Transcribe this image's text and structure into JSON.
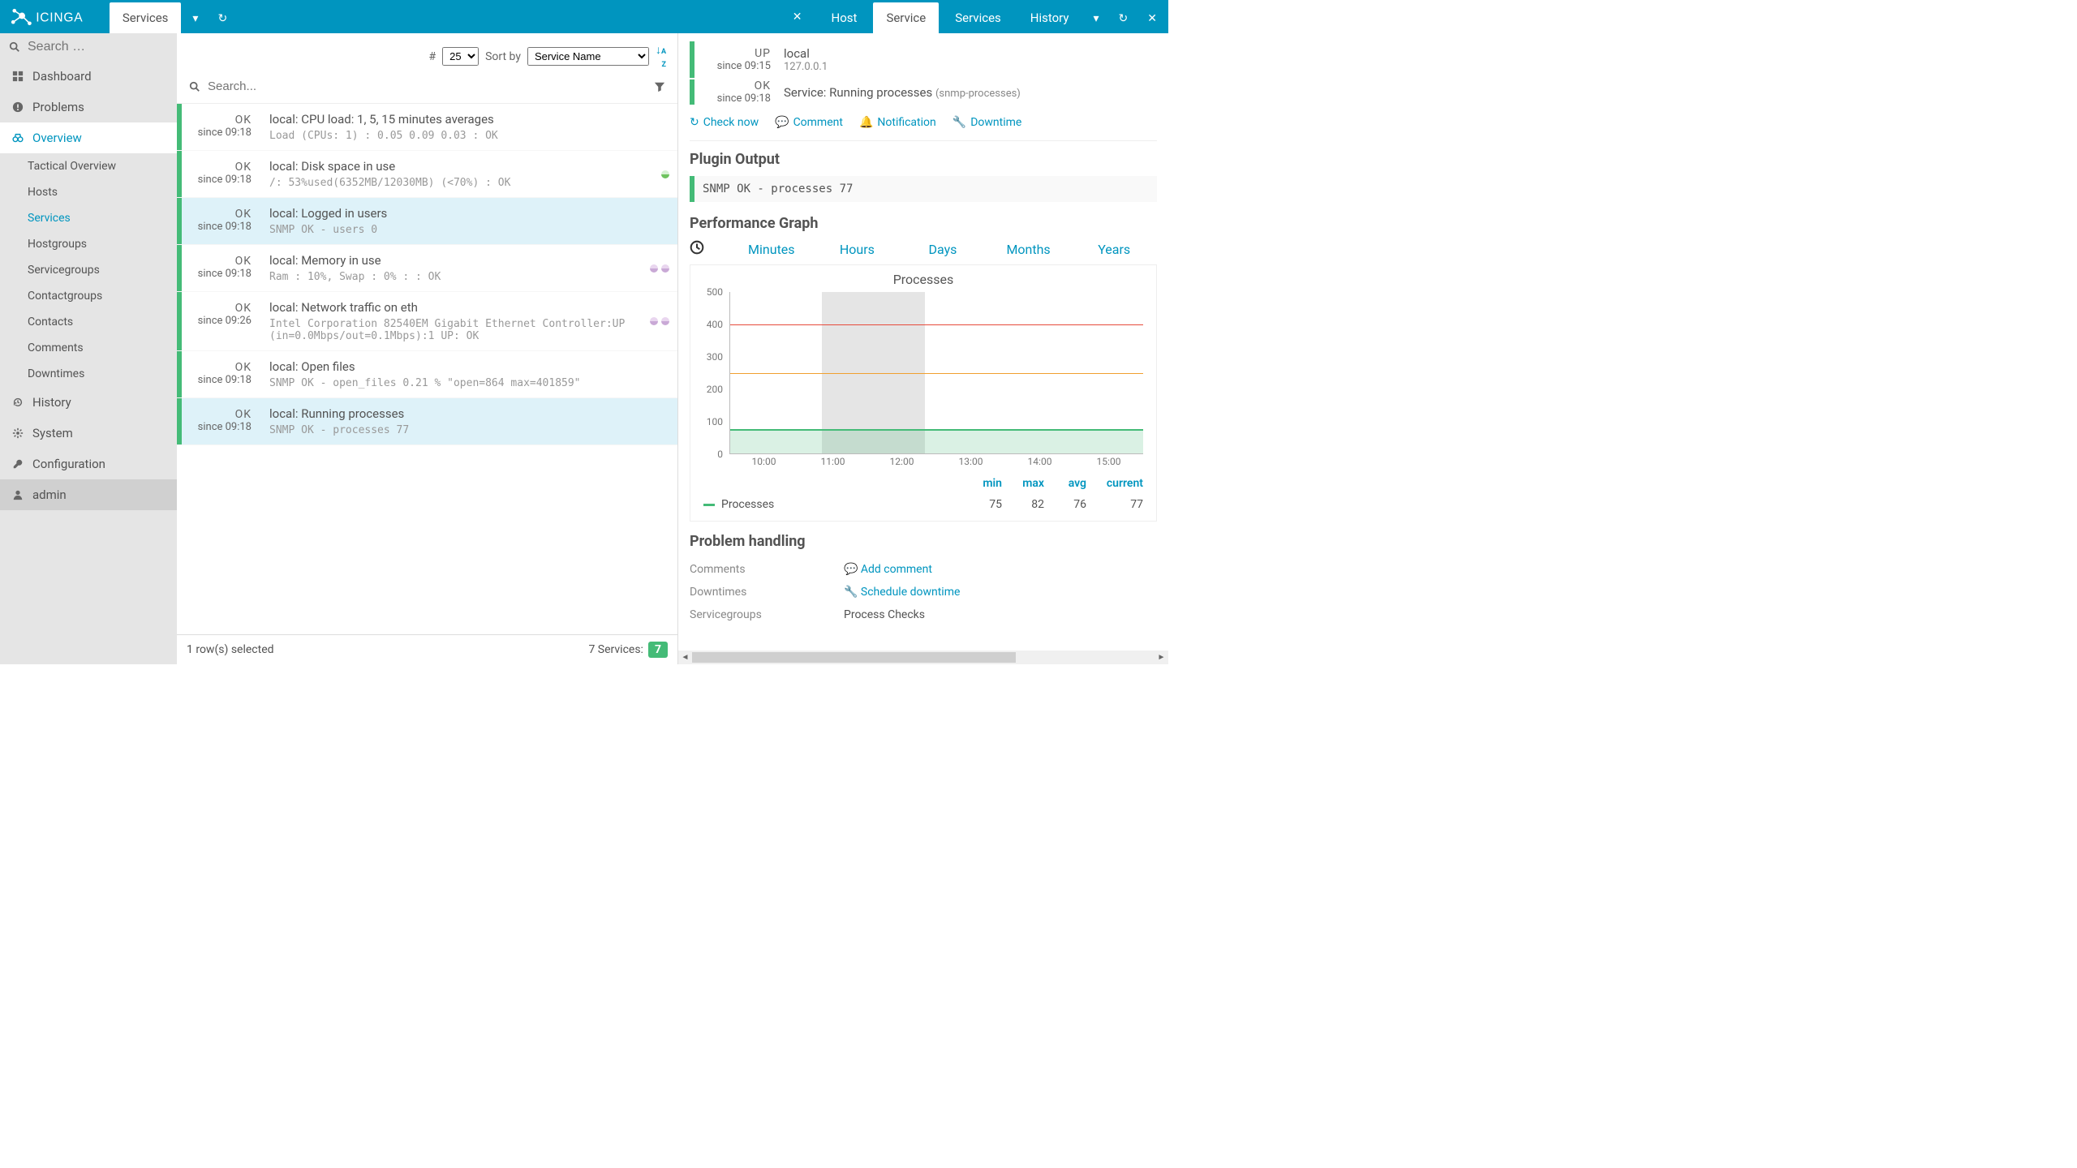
{
  "brand": "ICINGA",
  "topbar": {
    "left_tabs": [
      {
        "label": "Services",
        "active": true
      }
    ],
    "right_tabs": [
      {
        "label": "Host",
        "active": false
      },
      {
        "label": "Service",
        "active": true
      },
      {
        "label": "Services",
        "active": false
      },
      {
        "label": "History",
        "active": false
      }
    ]
  },
  "sidebar": {
    "search_placeholder": "Search …",
    "items": [
      {
        "icon": "dashboard",
        "label": "Dashboard"
      },
      {
        "icon": "alert",
        "label": "Problems"
      },
      {
        "icon": "binoc",
        "label": "Overview",
        "active": true,
        "children": [
          {
            "label": "Tactical Overview"
          },
          {
            "label": "Hosts"
          },
          {
            "label": "Services",
            "active": true
          },
          {
            "label": "Hostgroups"
          },
          {
            "label": "Servicegroups"
          },
          {
            "label": "Contactgroups"
          },
          {
            "label": "Contacts"
          },
          {
            "label": "Comments"
          },
          {
            "label": "Downtimes"
          }
        ]
      },
      {
        "icon": "history",
        "label": "History"
      },
      {
        "icon": "gear",
        "label": "System"
      },
      {
        "icon": "wrench",
        "label": "Configuration"
      }
    ],
    "user": {
      "icon": "user",
      "label": "admin"
    }
  },
  "svc_controls": {
    "hash": "#",
    "page_size": "25",
    "sort_by_label": "Sort by",
    "sort_by_value": "Service Name"
  },
  "svc_search": {
    "placeholder": "Search..."
  },
  "services": [
    {
      "status": "OK",
      "since": "since 09:18",
      "title": "local: CPU load: 1, 5, 15 minutes averages",
      "output": "Load (CPUs: 1) : 0.05 0.09 0.03 : OK",
      "dots": []
    },
    {
      "status": "OK",
      "since": "since 09:18",
      "title": "local: Disk space in use",
      "output": "/: 53%used(6352MB/12030MB) (<70%) : OK",
      "dots": [
        {
          "c1": "#d6f1d3",
          "c2": "#6ec35f"
        }
      ]
    },
    {
      "status": "OK",
      "since": "since 09:18",
      "title": "local: Logged in users",
      "output": "SNMP OK - users 0",
      "dots": [],
      "selected": true
    },
    {
      "status": "OK",
      "since": "since 09:18",
      "title": "local: Memory in use",
      "output": "Ram : 10%, Swap : 0% : : OK",
      "dots": [
        {
          "c1": "#e9d6ef",
          "c2": "#c9a9d6"
        },
        {
          "c1": "#e9d6ef",
          "c2": "#c9a9d6"
        }
      ]
    },
    {
      "status": "OK",
      "since": "since 09:26",
      "title": "local: Network traffic on eth",
      "output": "Intel Corporation 82540EM Gigabit Ethernet Controller:UP (in=0.0Mbps/out=0.1Mbps):1 UP: OK",
      "dots": [
        {
          "c1": "#e9d6ef",
          "c2": "#c9a9d6"
        },
        {
          "c1": "#e9d6ef",
          "c2": "#c9a9d6"
        }
      ]
    },
    {
      "status": "OK",
      "since": "since 09:18",
      "title": "local: Open files",
      "output": "SNMP OK - open_files 0.21 % \"open=864 max=401859\"",
      "dots": []
    },
    {
      "status": "OK",
      "since": "since 09:18",
      "title": "local: Running processes",
      "output": "SNMP OK - processes 77",
      "dots": [],
      "selected": true
    }
  ],
  "svc_footer": {
    "selected_text": "1 row(s) selected",
    "total_label": "7 Services:",
    "ok_count": "7"
  },
  "detail": {
    "host": {
      "state": "UP",
      "since": "since 09:15",
      "name": "local",
      "addr": "127.0.0.1"
    },
    "service": {
      "state": "OK",
      "since": "since 09:18",
      "label_prefix": "Service: ",
      "name": "Running processes",
      "check": "(snmp-processes)"
    },
    "actions": {
      "check_now": "Check now",
      "comment": "Comment",
      "notification": "Notification",
      "downtime": "Downtime"
    },
    "plugin_heading": "Plugin Output",
    "plugin_output": "SNMP OK - processes 77",
    "perf_heading": "Performance Graph",
    "graph_tabs": [
      "Minutes",
      "Hours",
      "Days",
      "Months",
      "Years"
    ],
    "chart": {
      "title": "Processes",
      "legend_label": "Processes",
      "stats_head": [
        "min",
        "max",
        "avg",
        "current"
      ],
      "stats_vals": [
        "75",
        "82",
        "76",
        "77"
      ]
    },
    "problem_heading": "Problem handling",
    "problem_rows": [
      {
        "k": "Comments",
        "link": "Add comment",
        "icon": "comment"
      },
      {
        "k": "Downtimes",
        "link": "Schedule downtime",
        "icon": "wrench"
      },
      {
        "k": "Servicegroups",
        "text": "Process Checks"
      }
    ]
  },
  "chart_data": {
    "type": "line",
    "title": "Processes",
    "xlabel": "",
    "ylabel": "",
    "ylim": [
      0,
      500
    ],
    "y_ticks": [
      0,
      100,
      200,
      300,
      400,
      500
    ],
    "x_ticks": [
      "10:00",
      "11:00",
      "12:00",
      "13:00",
      "14:00",
      "15:00"
    ],
    "x_range_hours": [
      9.5,
      15.5
    ],
    "series": [
      {
        "name": "Processes",
        "color": "#44bb77",
        "approx_constant_value": 77,
        "stats": {
          "min": 75,
          "max": 82,
          "avg": 76,
          "current": 77
        }
      }
    ],
    "thresholds": [
      {
        "name": "critical",
        "value": 400,
        "color": "#e64b3c"
      },
      {
        "name": "warning",
        "value": 250,
        "color": "#f0a030"
      }
    ],
    "shaded_region_hours": [
      10.83,
      12.33
    ]
  }
}
